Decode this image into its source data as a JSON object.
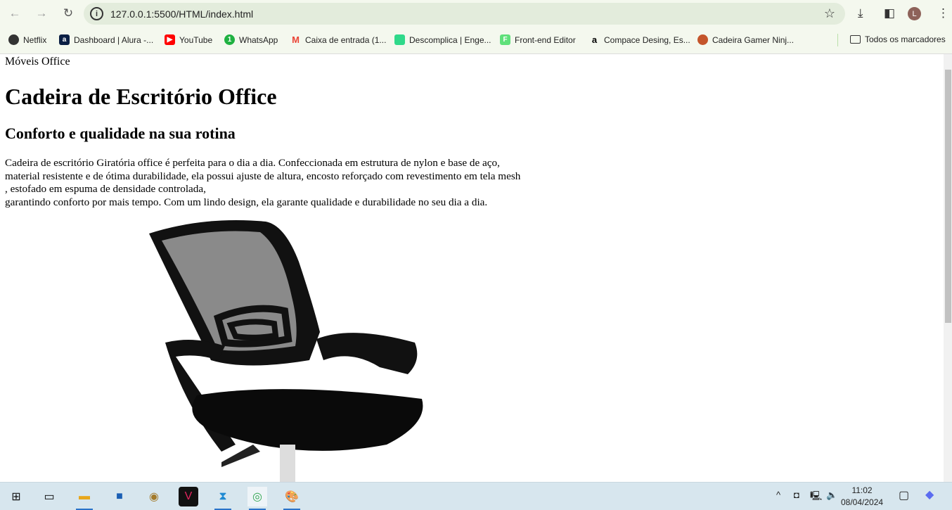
{
  "browser": {
    "url": "127.0.0.1:5500/HTML/index.html",
    "profile_initial": "L",
    "bookmarks": [
      {
        "label": "Netflix",
        "icon": "globe-icon",
        "color": "#333333"
      },
      {
        "label": "Dashboard | Alura -...",
        "icon": "alura-icon",
        "color": "#0a1f44"
      },
      {
        "label": "YouTube",
        "icon": "youtube-icon",
        "color": "#ff0000"
      },
      {
        "label": "WhatsApp",
        "icon": "whatsapp-icon",
        "color": "#1fb141"
      },
      {
        "label": "Caixa de entrada (1...",
        "icon": "gmail-icon",
        "color": "#ea4335"
      },
      {
        "label": "Descomplica | Enge...",
        "icon": "descomplica-icon",
        "color": "#2fd98a"
      },
      {
        "label": "Front-end Editor",
        "icon": "frontend-editor-icon",
        "color": "#5fe07a"
      },
      {
        "label": "Compace Desing, Es...",
        "icon": "amazon-icon",
        "color": "#f59b00"
      },
      {
        "label": "Cadeira Gamer Ninj...",
        "icon": "ninja-icon",
        "color": "#c4552b"
      }
    ],
    "all_bookmarks": "Todos os marcadores"
  },
  "page": {
    "brand": "Móveis Office",
    "title": "Cadeira de Escritório Office",
    "subtitle": "Conforto e qualidade na sua rotina",
    "description_lines": [
      "Cadeira de escritório Giratória office é perfeita para o dia a dia. Confeccionada em estrutura de nylon e base de aço,",
      "material resistente e de ótima durabilidade, ela possui ajuste de altura, encosto reforçado com revestimento em tela mesh",
      ", estofado em espuma de densidade controlada,",
      "garantindo conforto por mais tempo. Com um lindo design, ela garante qualidade e durabilidade no seu dia a dia."
    ]
  },
  "taskbar": {
    "time": "11:02",
    "date": "08/04/2024"
  }
}
